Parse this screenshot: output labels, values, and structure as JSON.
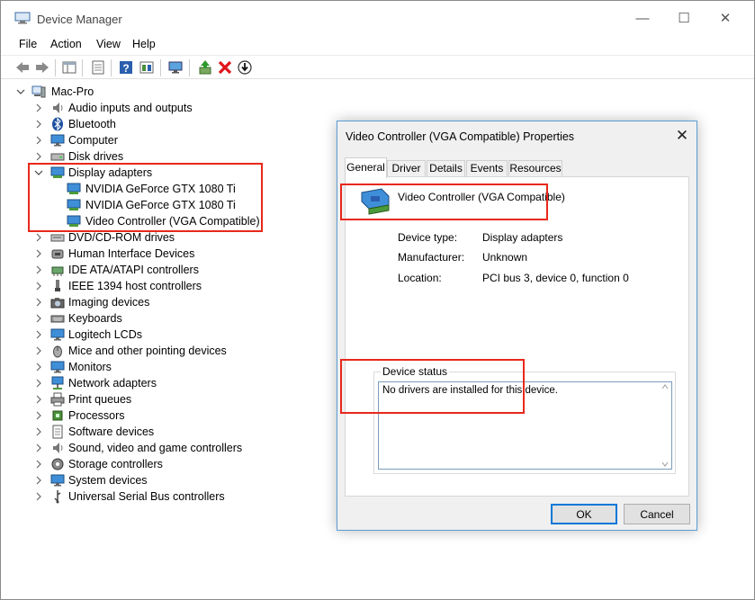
{
  "window": {
    "title": "Device Manager",
    "caption": {
      "minimize": "—",
      "maximize": "☐",
      "close": "✕"
    }
  },
  "menu": [
    "File",
    "Action",
    "View",
    "Help"
  ],
  "toolbar": [
    "back-icon",
    "forward-icon",
    "show-hide-console-tree-icon",
    "properties-icon",
    "help-icon",
    "show-hidden-icon",
    "monitor-icon",
    "update-driver-icon",
    "uninstall-icon",
    "download-icon"
  ],
  "tree": {
    "root": "Mac-Pro",
    "categories": [
      "Audio inputs and outputs",
      "Bluetooth",
      "Computer",
      "Disk drives",
      "Display adapters",
      "DVD/CD-ROM drives",
      "Human Interface Devices",
      "IDE ATA/ATAPI controllers",
      "IEEE 1394 host controllers",
      "Imaging devices",
      "Keyboards",
      "Logitech LCDs",
      "Mice and other pointing devices",
      "Monitors",
      "Network adapters",
      "Print queues",
      "Processors",
      "Software devices",
      "Sound, video and game controllers",
      "Storage controllers",
      "System devices",
      "Universal Serial Bus controllers"
    ],
    "display_children": [
      "NVIDIA GeForce GTX 1080 Ti",
      "NVIDIA GeForce GTX 1080 Ti",
      "Video Controller (VGA Compatible)"
    ]
  },
  "dialog": {
    "title": "Video Controller (VGA Compatible) Properties",
    "close": "✕",
    "tabs": [
      "General",
      "Driver",
      "Details",
      "Events",
      "Resources"
    ],
    "device_name": "Video Controller (VGA Compatible)",
    "props": {
      "type_label": "Device type:",
      "type_value": "Display adapters",
      "mfr_label": "Manufacturer:",
      "mfr_value": "Unknown",
      "loc_label": "Location:",
      "loc_value": "PCI bus 3, device 0, function 0"
    },
    "status_legend": "Device status",
    "status_text": "No drivers are installed for this device.",
    "ok": "OK",
    "cancel": "Cancel"
  },
  "colors": {
    "highlight": "#e8281b",
    "accent": "#0078d7"
  }
}
